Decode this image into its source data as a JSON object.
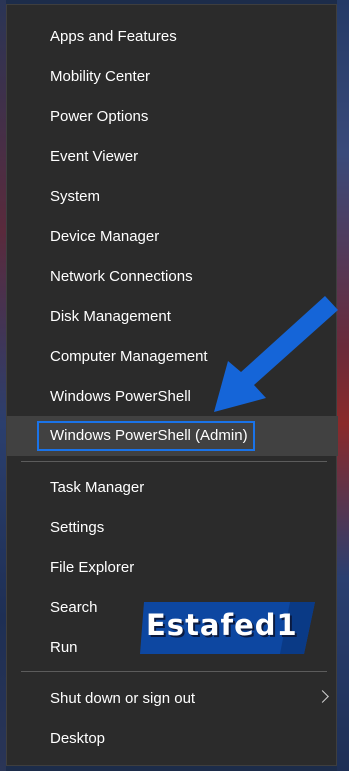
{
  "menu": {
    "group1": [
      {
        "label": "Apps and Features"
      },
      {
        "label": "Mobility Center"
      },
      {
        "label": "Power Options"
      },
      {
        "label": "Event Viewer"
      },
      {
        "label": "System"
      },
      {
        "label": "Device Manager"
      },
      {
        "label": "Network Connections"
      },
      {
        "label": "Disk Management"
      },
      {
        "label": "Computer Management"
      },
      {
        "label": "Windows PowerShell"
      },
      {
        "label": "Windows PowerShell (Admin)",
        "highlighted": true
      }
    ],
    "group2": [
      {
        "label": "Task Manager"
      },
      {
        "label": "Settings"
      },
      {
        "label": "File Explorer"
      },
      {
        "label": "Search"
      },
      {
        "label": "Run"
      }
    ],
    "group3": [
      {
        "label": "Shut down or sign out",
        "has_submenu": true,
        "icon": "chevron-right-icon"
      },
      {
        "label": "Desktop"
      }
    ]
  },
  "watermark": {
    "text": "Estafed1"
  },
  "colors": {
    "menu_bg": "#2b2b2b",
    "highlight_bg": "#414141",
    "focus_border": "#1a73e8",
    "arrow": "#1565d8",
    "text": "#ffffff"
  }
}
